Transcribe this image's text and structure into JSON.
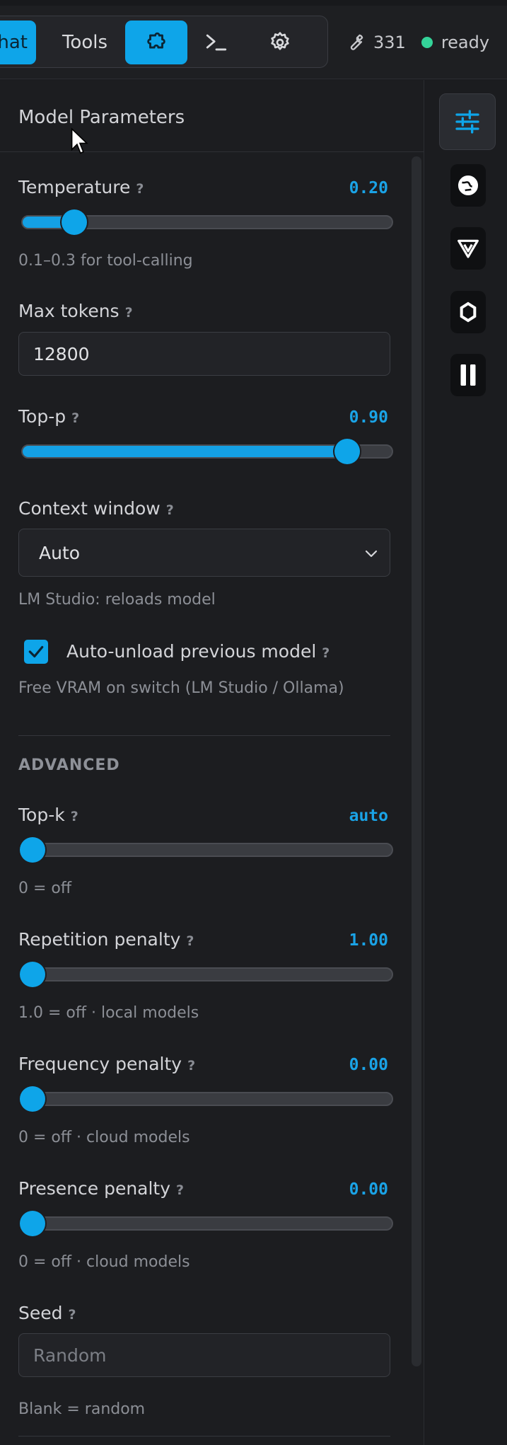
{
  "topbar": {
    "tabs": [
      {
        "label": "hat",
        "icon": null,
        "active": true
      },
      {
        "label": "Tools",
        "icon": null,
        "active": false
      },
      {
        "label": "",
        "icon": "puzzle-icon",
        "active": true
      },
      {
        "label": "",
        "icon": "terminal-icon",
        "active": false
      },
      {
        "label": "",
        "icon": "gear-icon",
        "active": false
      }
    ],
    "tool_count": "331",
    "status": "ready",
    "accent": "#0ea5e9",
    "status_color": "#34d399"
  },
  "panel": {
    "title": "Model Parameters",
    "help_glyph": "?",
    "temperature": {
      "label": "Temperature",
      "value": "0.20",
      "level": 0.12,
      "hint": "0.1–0.3 for tool-calling"
    },
    "max_tokens": {
      "label": "Max tokens",
      "value": "12800"
    },
    "top_p": {
      "label": "Top-p",
      "value": "0.90",
      "level": 0.9
    },
    "context_window": {
      "label": "Context window",
      "selected": "Auto",
      "hint": "LM Studio: reloads model"
    },
    "auto_unload": {
      "label": "Auto-unload previous model",
      "checked": true,
      "hint": "Free VRAM on switch (LM Studio / Ollama)"
    },
    "advanced_heading": "ADVANCED",
    "top_k": {
      "label": "Top-k",
      "value": "auto",
      "level": 0.0,
      "hint": "0 = off"
    },
    "repetition_penalty": {
      "label": "Repetition penalty",
      "value": "1.00",
      "level": 0.0,
      "hint": "1.0 = off · local models"
    },
    "frequency_penalty": {
      "label": "Frequency penalty",
      "value": "0.00",
      "level": 0.0,
      "hint": "0 = off · cloud models"
    },
    "presence_penalty": {
      "label": "Presence penalty",
      "value": "0.00",
      "level": 0.0,
      "hint": "0 = off · cloud models"
    },
    "seed": {
      "label": "Seed",
      "placeholder": "Random",
      "hint": "Blank = random"
    }
  },
  "rail": {
    "buttons": [
      {
        "icon": "sliders-icon",
        "active": true
      },
      {
        "icon": "globe-icon",
        "active": false
      },
      {
        "icon": "v-logo-icon",
        "active": false
      },
      {
        "icon": "circle-ring-icon",
        "active": false
      },
      {
        "icon": "pause-icon",
        "active": false
      }
    ]
  }
}
